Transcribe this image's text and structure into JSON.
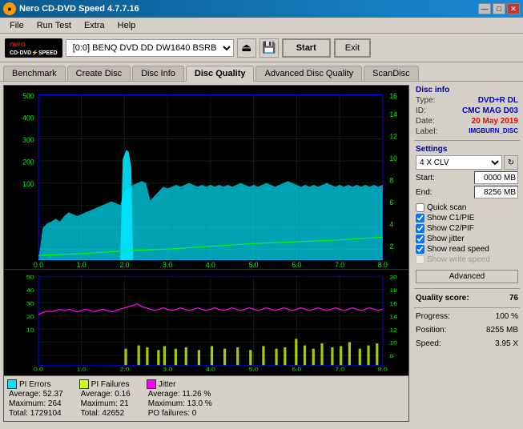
{
  "titleBar": {
    "title": "Nero CD-DVD Speed 4.7.7.16",
    "icon": "●",
    "buttons": [
      "—",
      "□",
      "✕"
    ]
  },
  "menu": {
    "items": [
      "File",
      "Run Test",
      "Extra",
      "Help"
    ]
  },
  "toolbar": {
    "drive_path": "[0:0]",
    "drive_name": "BENQ DVD DD DW1640 BSRB",
    "start_label": "Start",
    "exit_label": "Exit"
  },
  "tabs": [
    {
      "label": "Benchmark",
      "active": false
    },
    {
      "label": "Create Disc",
      "active": false
    },
    {
      "label": "Disc Info",
      "active": false
    },
    {
      "label": "Disc Quality",
      "active": true
    },
    {
      "label": "Advanced Disc Quality",
      "active": false
    },
    {
      "label": "ScanDisc",
      "active": false
    }
  ],
  "discInfo": {
    "section_label": "Disc info",
    "type_label": "Type:",
    "type_val": "DVD+R DL",
    "id_label": "ID:",
    "id_val": "CMC MAG D03",
    "date_label": "Date:",
    "date_val": "20 May 2019",
    "label_label": "Label:",
    "label_val": "IMGBURN_DISC"
  },
  "settings": {
    "section_label": "Settings",
    "speed_value": "4 X CLV",
    "start_label": "Start:",
    "start_val": "0000 MB",
    "end_label": "End:",
    "end_val": "8256 MB",
    "quick_scan": "Quick scan",
    "show_c1pie": "Show C1/PIE",
    "show_c2pif": "Show C2/PIF",
    "show_jitter": "Show jitter",
    "show_read": "Show read speed",
    "show_write": "Show write speed",
    "advanced_label": "Advanced"
  },
  "quality": {
    "score_label": "Quality score:",
    "score_val": "76",
    "progress_label": "Progress:",
    "progress_val": "100 %",
    "position_label": "Position:",
    "position_val": "8255 MB",
    "speed_label": "Speed:",
    "speed_val": "3.95 X"
  },
  "legend": {
    "pi_errors": {
      "label": "PI Errors",
      "color": "#00e5ff",
      "avg_label": "Average:",
      "avg_val": "52.37",
      "max_label": "Maximum:",
      "max_val": "264",
      "total_label": "Total:",
      "total_val": "1729104"
    },
    "pi_failures": {
      "label": "PI Failures",
      "color": "#ccff00",
      "avg_label": "Average:",
      "avg_val": "0.16",
      "max_label": "Maximum:",
      "max_val": "21",
      "total_label": "Total:",
      "total_val": "42652"
    },
    "jitter": {
      "label": "Jitter",
      "color": "#ff00ff",
      "avg_label": "Average:",
      "avg_val": "11.26 %",
      "max_label": "Maximum:",
      "max_val": "13.0 %"
    },
    "po_failures": {
      "label": "PO failures:",
      "val": "0"
    }
  },
  "chart": {
    "top_ymax": "500",
    "top_right_labels": [
      "16",
      "14",
      "12",
      "10",
      "8",
      "6",
      "4",
      "2"
    ],
    "bottom_ymax": "50",
    "bottom_right_labels": [
      "20",
      "18",
      "16",
      "14",
      "12",
      "10",
      "8"
    ],
    "x_labels": [
      "0.0",
      "1.0",
      "2.0",
      "3.0",
      "4.0",
      "5.0",
      "6.0",
      "7.0",
      "8.0"
    ]
  }
}
